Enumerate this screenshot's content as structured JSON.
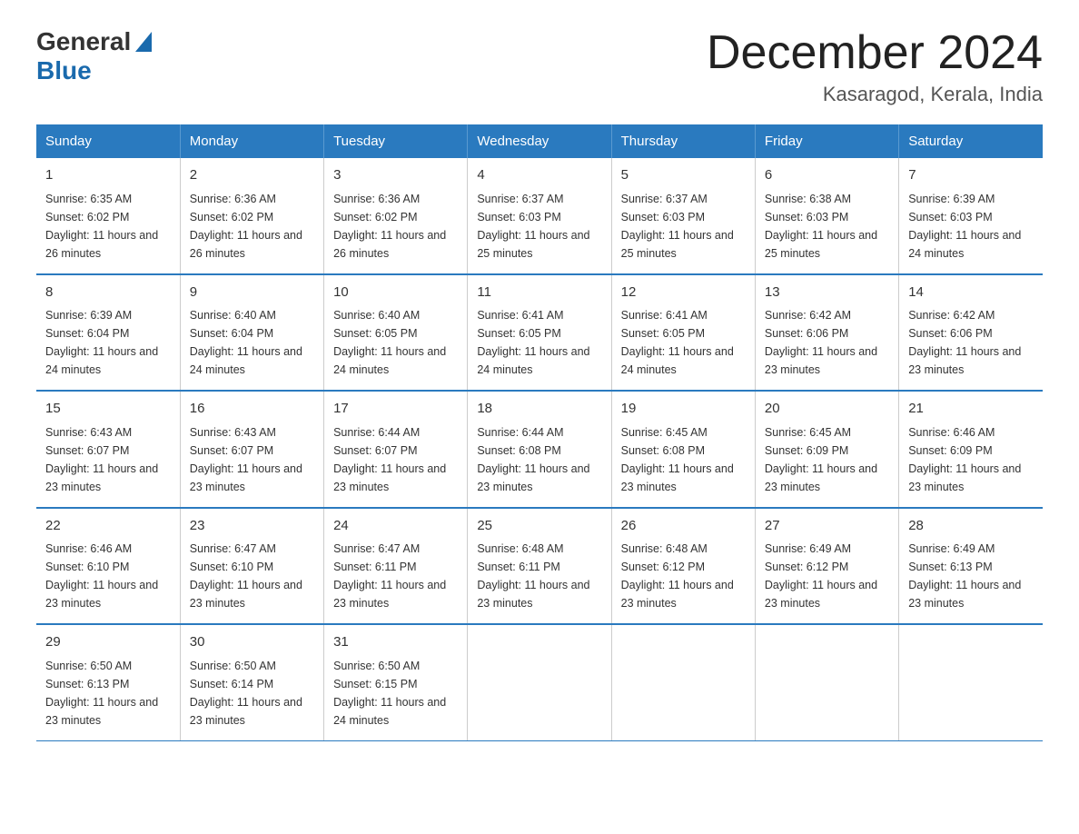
{
  "header": {
    "logo": {
      "general": "General",
      "blue": "Blue"
    },
    "title": "December 2024",
    "location": "Kasaragod, Kerala, India"
  },
  "calendar": {
    "days_of_week": [
      "Sunday",
      "Monday",
      "Tuesday",
      "Wednesday",
      "Thursday",
      "Friday",
      "Saturday"
    ],
    "weeks": [
      [
        {
          "day": "1",
          "sunrise": "6:35 AM",
          "sunset": "6:02 PM",
          "daylight": "11 hours and 26 minutes."
        },
        {
          "day": "2",
          "sunrise": "6:36 AM",
          "sunset": "6:02 PM",
          "daylight": "11 hours and 26 minutes."
        },
        {
          "day": "3",
          "sunrise": "6:36 AM",
          "sunset": "6:02 PM",
          "daylight": "11 hours and 26 minutes."
        },
        {
          "day": "4",
          "sunrise": "6:37 AM",
          "sunset": "6:03 PM",
          "daylight": "11 hours and 25 minutes."
        },
        {
          "day": "5",
          "sunrise": "6:37 AM",
          "sunset": "6:03 PM",
          "daylight": "11 hours and 25 minutes."
        },
        {
          "day": "6",
          "sunrise": "6:38 AM",
          "sunset": "6:03 PM",
          "daylight": "11 hours and 25 minutes."
        },
        {
          "day": "7",
          "sunrise": "6:39 AM",
          "sunset": "6:03 PM",
          "daylight": "11 hours and 24 minutes."
        }
      ],
      [
        {
          "day": "8",
          "sunrise": "6:39 AM",
          "sunset": "6:04 PM",
          "daylight": "11 hours and 24 minutes."
        },
        {
          "day": "9",
          "sunrise": "6:40 AM",
          "sunset": "6:04 PM",
          "daylight": "11 hours and 24 minutes."
        },
        {
          "day": "10",
          "sunrise": "6:40 AM",
          "sunset": "6:05 PM",
          "daylight": "11 hours and 24 minutes."
        },
        {
          "day": "11",
          "sunrise": "6:41 AM",
          "sunset": "6:05 PM",
          "daylight": "11 hours and 24 minutes."
        },
        {
          "day": "12",
          "sunrise": "6:41 AM",
          "sunset": "6:05 PM",
          "daylight": "11 hours and 24 minutes."
        },
        {
          "day": "13",
          "sunrise": "6:42 AM",
          "sunset": "6:06 PM",
          "daylight": "11 hours and 23 minutes."
        },
        {
          "day": "14",
          "sunrise": "6:42 AM",
          "sunset": "6:06 PM",
          "daylight": "11 hours and 23 minutes."
        }
      ],
      [
        {
          "day": "15",
          "sunrise": "6:43 AM",
          "sunset": "6:07 PM",
          "daylight": "11 hours and 23 minutes."
        },
        {
          "day": "16",
          "sunrise": "6:43 AM",
          "sunset": "6:07 PM",
          "daylight": "11 hours and 23 minutes."
        },
        {
          "day": "17",
          "sunrise": "6:44 AM",
          "sunset": "6:07 PM",
          "daylight": "11 hours and 23 minutes."
        },
        {
          "day": "18",
          "sunrise": "6:44 AM",
          "sunset": "6:08 PM",
          "daylight": "11 hours and 23 minutes."
        },
        {
          "day": "19",
          "sunrise": "6:45 AM",
          "sunset": "6:08 PM",
          "daylight": "11 hours and 23 minutes."
        },
        {
          "day": "20",
          "sunrise": "6:45 AM",
          "sunset": "6:09 PM",
          "daylight": "11 hours and 23 minutes."
        },
        {
          "day": "21",
          "sunrise": "6:46 AM",
          "sunset": "6:09 PM",
          "daylight": "11 hours and 23 minutes."
        }
      ],
      [
        {
          "day": "22",
          "sunrise": "6:46 AM",
          "sunset": "6:10 PM",
          "daylight": "11 hours and 23 minutes."
        },
        {
          "day": "23",
          "sunrise": "6:47 AM",
          "sunset": "6:10 PM",
          "daylight": "11 hours and 23 minutes."
        },
        {
          "day": "24",
          "sunrise": "6:47 AM",
          "sunset": "6:11 PM",
          "daylight": "11 hours and 23 minutes."
        },
        {
          "day": "25",
          "sunrise": "6:48 AM",
          "sunset": "6:11 PM",
          "daylight": "11 hours and 23 minutes."
        },
        {
          "day": "26",
          "sunrise": "6:48 AM",
          "sunset": "6:12 PM",
          "daylight": "11 hours and 23 minutes."
        },
        {
          "day": "27",
          "sunrise": "6:49 AM",
          "sunset": "6:12 PM",
          "daylight": "11 hours and 23 minutes."
        },
        {
          "day": "28",
          "sunrise": "6:49 AM",
          "sunset": "6:13 PM",
          "daylight": "11 hours and 23 minutes."
        }
      ],
      [
        {
          "day": "29",
          "sunrise": "6:50 AM",
          "sunset": "6:13 PM",
          "daylight": "11 hours and 23 minutes."
        },
        {
          "day": "30",
          "sunrise": "6:50 AM",
          "sunset": "6:14 PM",
          "daylight": "11 hours and 23 minutes."
        },
        {
          "day": "31",
          "sunrise": "6:50 AM",
          "sunset": "6:15 PM",
          "daylight": "11 hours and 24 minutes."
        },
        null,
        null,
        null,
        null
      ]
    ],
    "labels": {
      "sunrise": "Sunrise:",
      "sunset": "Sunset:",
      "daylight": "Daylight:"
    }
  }
}
